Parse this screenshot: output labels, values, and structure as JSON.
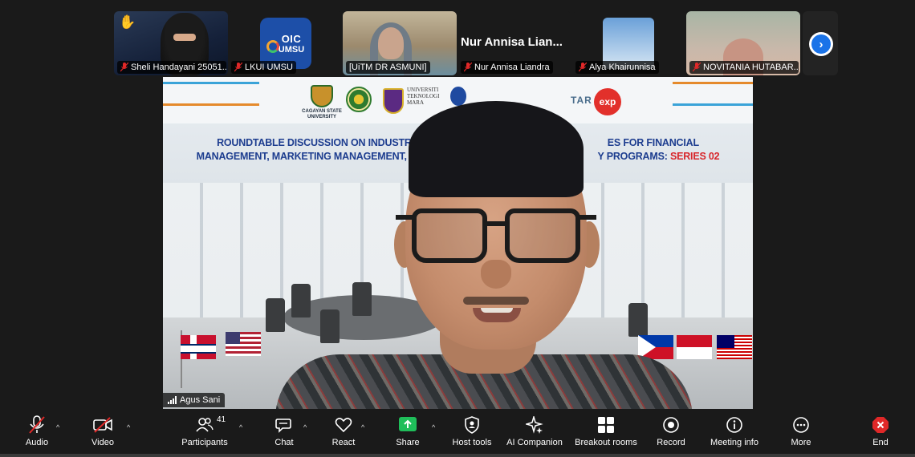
{
  "participants": [
    {
      "name": "Sheli Handayani 25051...",
      "muted": true,
      "hand_raised": true
    },
    {
      "name": "LKUI UMSU",
      "muted": true,
      "avatar_text_1": "OIC",
      "avatar_text_2": "UMSU"
    },
    {
      "name": "[UiTM DR ASMUNI]",
      "muted": false
    },
    {
      "name": "Nur Annisa Liandra",
      "muted": true,
      "display_name": "Nur Annisa Lian..."
    },
    {
      "name": "Alya Khairunnisa",
      "muted": true
    },
    {
      "name": "NOVITANIA HUTABAR...",
      "muted": true
    }
  ],
  "next_page_icon": "chevron-right-icon",
  "main_video": {
    "speaker_name": "Agus Sani",
    "banner": {
      "title_line1": "ROUNDTABLE DISCUSSION ON INDUSTRY",
      "title_line1_right": "ES FOR FINANCIAL",
      "title_line2_left": "MANAGEMENT, MARKETING MANAGEMENT, E",
      "title_line2_right": "Y PROGRAMS: ",
      "series": "SERIES 02",
      "logo_cagayan": "CAGAYAN STATE UNIVERSITY",
      "logo_uitm": "UNIVERSITI TEKNOLOGI MARA",
      "logo_tar": "TAR",
      "logo_exp": "exp"
    }
  },
  "toolbar": {
    "audio": "Audio",
    "video": "Video",
    "participants": "Participants",
    "participants_count": "41",
    "chat": "Chat",
    "react": "React",
    "share": "Share",
    "host_tools": "Host tools",
    "ai_companion": "AI Companion",
    "breakout_rooms": "Breakout rooms",
    "record": "Record",
    "meeting_info": "Meeting info",
    "more": "More",
    "end": "End"
  },
  "colors": {
    "background": "#1a1a1a",
    "mute_red": "#e02828",
    "share_green": "#1fbe5a",
    "end_red": "#e02828",
    "next_blue": "#1a73e8"
  }
}
